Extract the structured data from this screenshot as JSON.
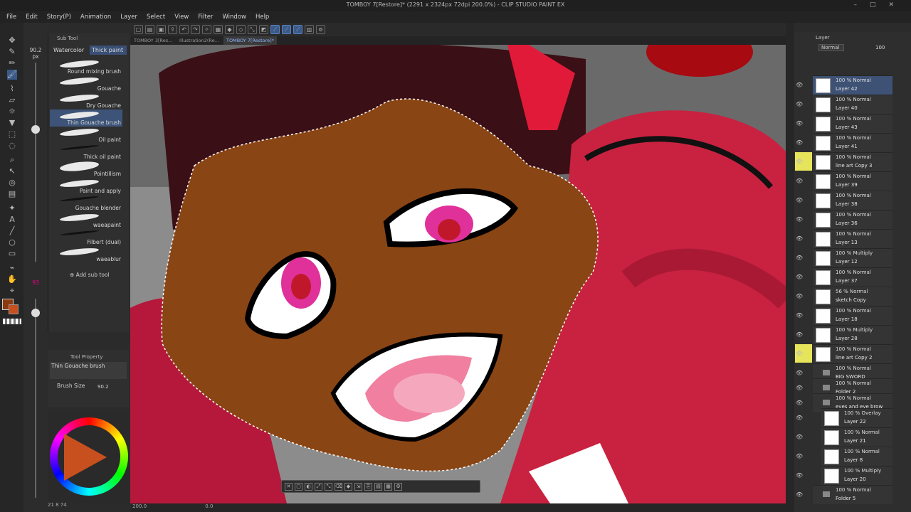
{
  "window": {
    "title": "TOMBOY 7[Restore]* (2291 x 2324px 72dpi 200.0%) - CLIP STUDIO PAINT EX"
  },
  "menu": [
    "File",
    "Edit",
    "Story(P)",
    "Animation",
    "Layer",
    "Select",
    "View",
    "Filter",
    "Window",
    "Help"
  ],
  "tools": {
    "brush_size_value": "90.2",
    "brush_size_unit": "px",
    "opacity_value": "93"
  },
  "subtool": {
    "title": "Sub Tool",
    "tabs": [
      "Watercolor",
      "Thick paint"
    ],
    "brushes": [
      "Round mixing brush",
      "Gouache",
      "Dry Gouache",
      "Thin Gouache brush",
      "Oil paint",
      "Thick oil paint",
      "Pointillism",
      "Paint and apply",
      "Gouache blender",
      "waeapaint",
      "Filbert (dual)",
      "waeablur"
    ],
    "add_label": "Add sub tool"
  },
  "tool_property": {
    "title": "Tool Property",
    "brush": "Thin Gouache brush",
    "size_label": "Brush Size",
    "size_value": "90.2"
  },
  "doc_tabs": [
    "TOMBOY 3[Res...",
    "Illustration2(Re...",
    "TOMBOY 7[Restore]*"
  ],
  "status": {
    "zoom": "200.0",
    "angle": "0.0",
    "coords": "21  8  74"
  },
  "layer_panel": {
    "title": "Layer",
    "blend": "Normal",
    "opacity": "100",
    "layers": [
      {
        "mode": "100 % Normal",
        "name": "Layer 42"
      },
      {
        "mode": "100 % Normal",
        "name": "Layer 40"
      },
      {
        "mode": "100 % Normal",
        "name": "Layer 43"
      },
      {
        "mode": "100 % Normal",
        "name": "Layer 41"
      },
      {
        "mode": "100 % Normal",
        "name": "line art Copy 3"
      },
      {
        "mode": "100 % Normal",
        "name": "Layer 39"
      },
      {
        "mode": "100 % Normal",
        "name": "Layer 38"
      },
      {
        "mode": "100 % Normal",
        "name": "Layer 36"
      },
      {
        "mode": "100 % Normal",
        "name": "Layer 13"
      },
      {
        "mode": "100 % Multiply",
        "name": "Layer 12"
      },
      {
        "mode": "100 % Normal",
        "name": "Layer 37"
      },
      {
        "mode": "56 % Normal",
        "name": "sketch Copy"
      },
      {
        "mode": "100 % Normal",
        "name": "Layer 18"
      },
      {
        "mode": "100 % Multiply",
        "name": "Layer 28"
      },
      {
        "mode": "100 % Normal",
        "name": "line art Copy 2"
      }
    ],
    "folders": [
      {
        "mode": "100 % Normal",
        "name": "BIG SWORD"
      },
      {
        "mode": "100 % Normal",
        "name": "Folder 2"
      },
      {
        "mode": "100 % Normal",
        "name": "eyes and eye brow"
      }
    ],
    "sublayers": [
      {
        "mode": "100 % Overlay",
        "name": "Layer 22"
      },
      {
        "mode": "100 % Normal",
        "name": "Layer 21"
      },
      {
        "mode": "100 % Normal",
        "name": "Layer 8"
      },
      {
        "mode": "100 % Multiply",
        "name": "Layer 20"
      }
    ],
    "last_folder": {
      "mode": "100 % Normal",
      "name": "Folder 5"
    }
  }
}
